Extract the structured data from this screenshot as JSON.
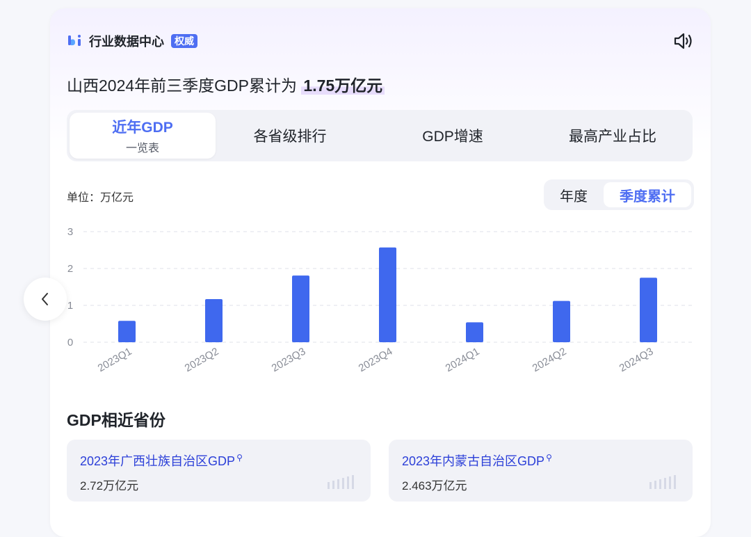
{
  "header": {
    "brand": "行业数据中心",
    "badge": "权威"
  },
  "headline": {
    "prefix": "山西2024年前三季度GDP累计为",
    "value": "1.75万亿元"
  },
  "tabs": [
    {
      "label": "近年GDP",
      "sublabel": "一览表"
    },
    {
      "label": "各省级排行"
    },
    {
      "label": "GDP增速"
    },
    {
      "label": "最高产业占比"
    }
  ],
  "unit_label": "单位：万亿元",
  "toggle": {
    "annual": "年度",
    "quarterly": "季度累计"
  },
  "chart_data": {
    "type": "bar",
    "categories": [
      "2023Q1",
      "2023Q2",
      "2023Q3",
      "2023Q4",
      "2024Q1",
      "2024Q2",
      "2024Q3"
    ],
    "values": [
      0.58,
      1.17,
      1.81,
      2.57,
      0.54,
      1.12,
      1.75
    ],
    "ylim": [
      0,
      3
    ],
    "yticks": [
      0,
      1,
      2,
      3
    ],
    "grid": true,
    "bar_color": "#3f68ee"
  },
  "similar": {
    "title": "GDP相近省份",
    "items": [
      {
        "name": "2023年广西壮族自治区GDP",
        "value": "2.72万亿元"
      },
      {
        "name": "2023年内蒙古自治区GDP",
        "value": "2.463万亿元"
      }
    ]
  },
  "colors": {
    "accent": "#4e6ef2",
    "link": "#2b3fd8",
    "bar": "#3f68ee"
  }
}
